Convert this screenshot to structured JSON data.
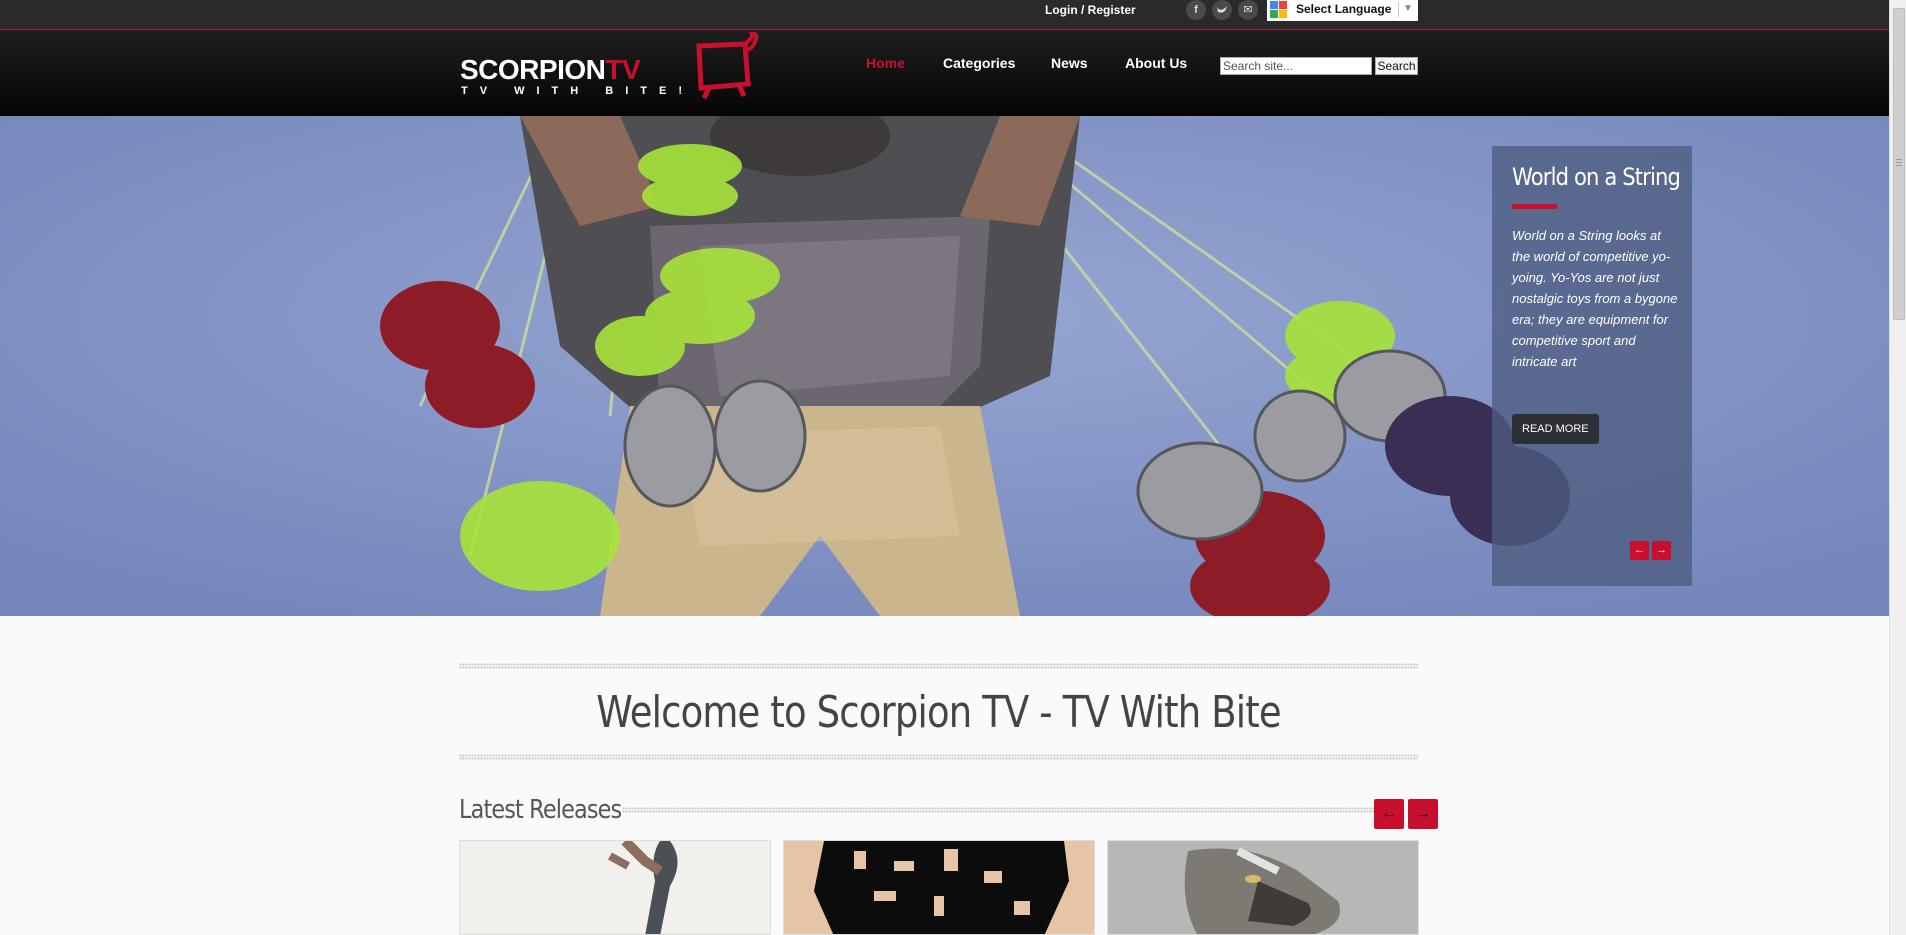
{
  "topbar": {
    "login_label": "Login / Register",
    "social": [
      {
        "icon": "facebook-icon",
        "glyph": "f"
      },
      {
        "icon": "twitter-icon",
        "glyph": "t"
      },
      {
        "icon": "email-icon",
        "glyph": "✉"
      }
    ],
    "language_label": "Select Language",
    "language_arrow": "▼"
  },
  "header": {
    "logo_main": "SCORPION",
    "logo_tv": "TV",
    "logo_tagline": "TV WITH BITE!",
    "nav": [
      {
        "label": "Home",
        "active": true
      },
      {
        "label": "Categories",
        "active": false
      },
      {
        "label": "News",
        "active": false
      },
      {
        "label": "About Us",
        "active": false
      }
    ],
    "search_placeholder": "Search site...",
    "search_button": "Search"
  },
  "hero": {
    "title": "World on a String",
    "description": "World on a String looks at the world of competitive yo-yoing. Yo-Yos are not just nostalgic toys from a bygone era; they are equipment for competitive sport and intricate art",
    "read_more": "READ MORE",
    "prev_arrow": "←",
    "next_arrow": "→"
  },
  "main": {
    "welcome": "Welcome to Scorpion TV - TV With Bite",
    "latest_title": "Latest Releases",
    "prev_arrow": "←",
    "next_arrow": "→"
  },
  "colors": {
    "brand_red": "#c8102e",
    "topbar": "#2a2a2a",
    "hero_sky": "#8a9ccc"
  }
}
